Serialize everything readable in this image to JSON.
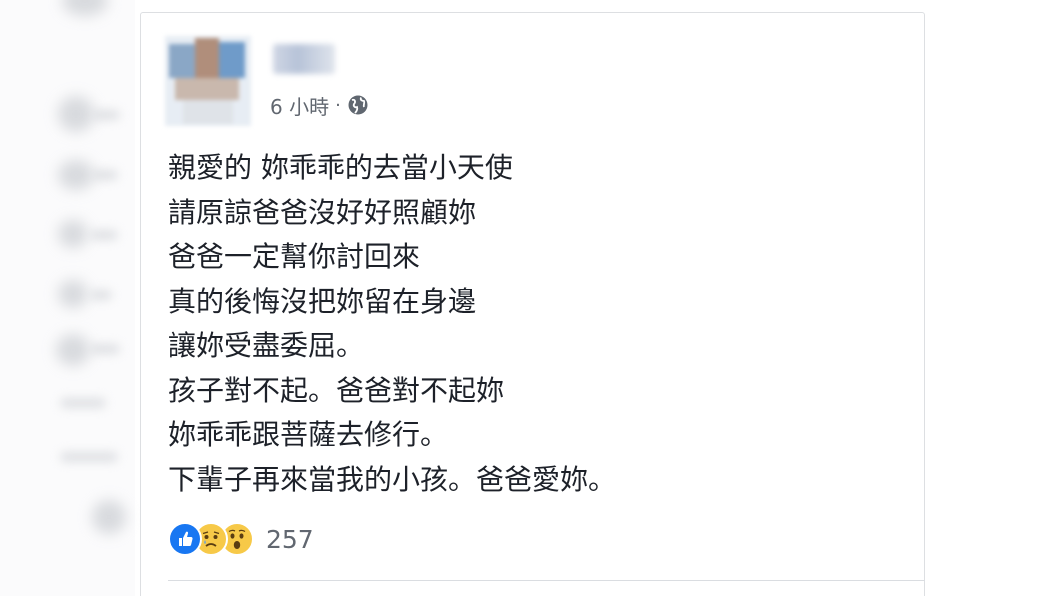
{
  "post": {
    "timestamp": "6 小時",
    "separator": "·",
    "privacy_icon": "globe-icon",
    "lines": [
      "親愛的 妳乖乖的去當小天使",
      "請原諒爸爸沒好好照顧妳",
      "爸爸一定幫你討回來",
      "真的後悔沒把妳留在身邊",
      "讓妳受盡委屈。",
      "孩子對不起。爸爸對不起妳",
      "妳乖乖跟菩薩去修行。",
      "下輩子再來當我的小孩。爸爸愛妳。"
    ],
    "reactions": {
      "icons": [
        "like-icon",
        "sad-icon",
        "wow-icon"
      ],
      "count": "257"
    }
  },
  "colors": {
    "text": "#1d2129",
    "meta": "#616770",
    "like": "#1877f2",
    "emoji": "#f7c948",
    "border": "#dddfe2"
  }
}
